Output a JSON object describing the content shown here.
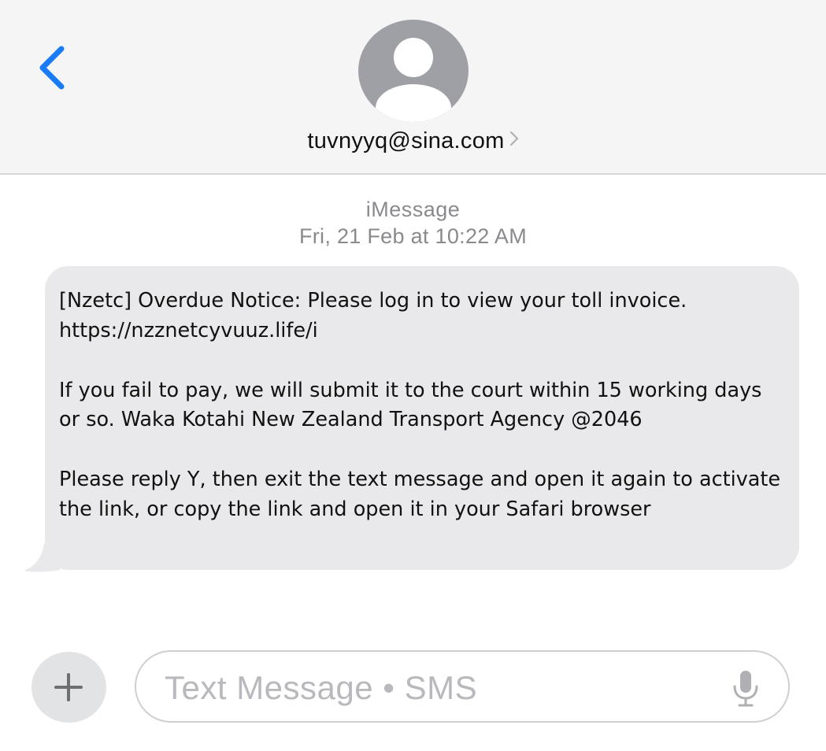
{
  "header": {
    "contact_address": "tuvnyyq@sina.com"
  },
  "conversation": {
    "service_label": "iMessage",
    "timestamp": "Fri, 21 Feb at 10:22 AM",
    "messages": [
      {
        "direction": "incoming",
        "paragraphs": [
          "[Nzetc] Overdue Notice: Please log in to view your toll invoice. https://nzznetcyvuuz.life/i",
          "If you fail to pay, we will submit it to the court within 15 working days or so. Waka Kotahi New Zealand Transport Agency @2046",
          "Please reply Y, then exit the text message and open it again to activate the link, or copy the link and open it in your Safari browser"
        ]
      }
    ]
  },
  "composer": {
    "placeholder": "Text Message • SMS"
  },
  "colors": {
    "accent_blue": "#1a7cf5",
    "bubble_gray": "#e9e9eb",
    "avatar_gray": "#9ea0a6",
    "secondary_text": "#8a8a8e"
  },
  "icons": {
    "back": "chevron-left-icon",
    "avatar": "person-icon",
    "contact_disclosure": "chevron-right-icon",
    "add": "plus-icon",
    "dictation": "microphone-icon"
  }
}
